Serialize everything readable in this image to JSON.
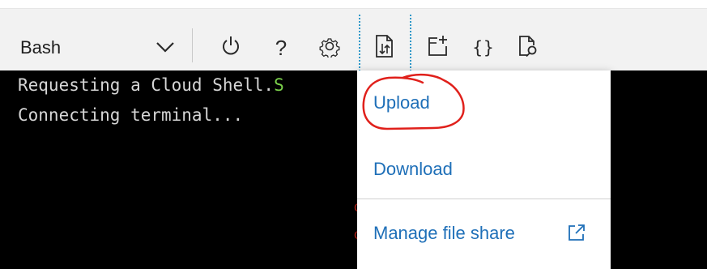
{
  "toolbar": {
    "shell_selected": "Bash",
    "help_glyph": "?",
    "editor_glyph": "{}",
    "icons": [
      "chevron-down-icon",
      "power-icon",
      "help-icon",
      "settings-gear-icon",
      "upload-download-file-icon",
      "new-session-icon",
      "editor-braces-icon",
      "web-preview-icon"
    ]
  },
  "terminal": {
    "line1_text": "Requesting a Cloud Shell.",
    "line1_suffix": "S",
    "line2_text": "Connecting terminal...",
    "bg_color": "#000000",
    "text_color": "#d6d6d6",
    "success_color": "#7bd14b"
  },
  "file_menu": {
    "upload_label": "Upload",
    "download_label": "Download",
    "manage_label": "Manage file share",
    "link_color": "#1e6fb8"
  },
  "annotation": {
    "color": "#e0201b",
    "target": "Upload"
  }
}
